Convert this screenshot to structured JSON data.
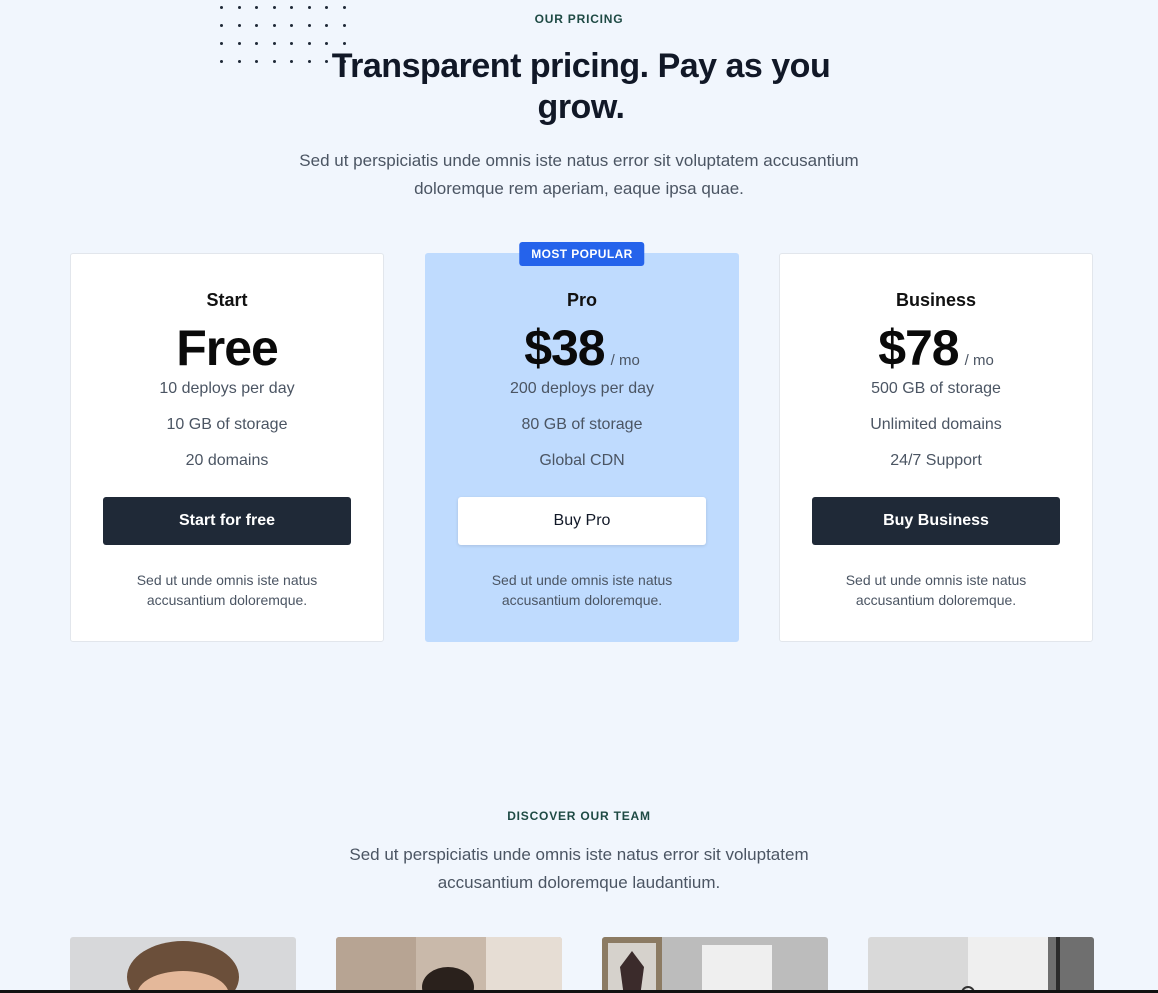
{
  "pricing": {
    "eyebrow": "OUR PRICING",
    "title": "Transparent pricing. Pay as you grow.",
    "lead_line1": "Sed ut perspiciatis unde omnis iste natus error sit voluptatem accusantium",
    "lead_line2": "doloremque rem aperiam, eaque ipsa quae.",
    "plans": [
      {
        "name": "Start",
        "price": "Free",
        "per": "",
        "features": [
          "10 deploys per day",
          "10 GB of storage",
          "20 domains"
        ],
        "button": "Start for free",
        "note": "Sed ut unde omnis iste natus accusantium doloremque."
      },
      {
        "badge": "MOST POPULAR",
        "name": "Pro",
        "price": "$38",
        "per": "/ mo",
        "features": [
          "200 deploys per day",
          "80 GB of storage",
          "Global CDN"
        ],
        "button": "Buy Pro",
        "note": "Sed ut unde omnis iste natus accusantium doloremque."
      },
      {
        "name": "Business",
        "price": "$78",
        "per": "/ mo",
        "features": [
          "500 GB of storage",
          "Unlimited domains",
          "24/7 Support"
        ],
        "button": "Buy Business",
        "note": "Sed ut unde omnis iste natus accusantium doloremque."
      }
    ]
  },
  "team": {
    "eyebrow": "DISCOVER OUR TEAM",
    "lead_line1": "Sed ut perspiciatis unde omnis iste natus error sit voluptatem",
    "lead_line2": "accusantium doloremque laudantium."
  },
  "colors": {
    "background": "#f1f6fd",
    "popular_card": "#bfdbfe",
    "badge": "#2563eb",
    "dark_button": "#1f2937"
  }
}
